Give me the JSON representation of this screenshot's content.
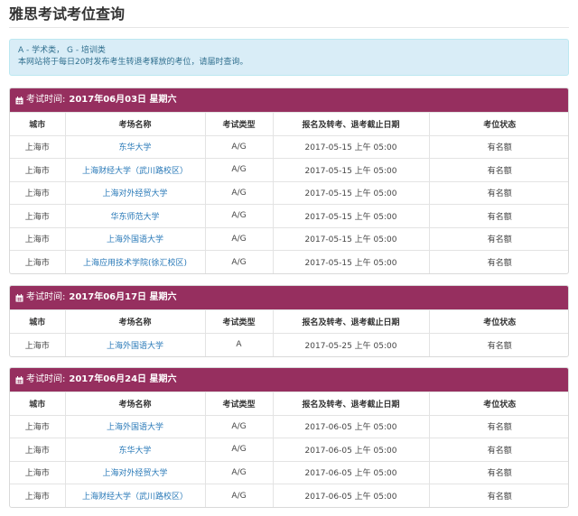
{
  "page": {
    "title": "雅思考试考位查询"
  },
  "info": {
    "line1": "A - 学术类， G - 培训类",
    "line2": "本网站将于每日20时发布考生转退考释放的考位，请届时查询。"
  },
  "columns": [
    "城市",
    "考场名称",
    "考试类型",
    "报名及转考、退考截止日期",
    "考位状态"
  ],
  "sections": [
    {
      "label": "考试时间:",
      "date": "2017年06月03日 星期六",
      "rows": [
        {
          "city": "上海市",
          "venue": "东华大学",
          "type": "A/G",
          "deadline": "2017-05-15 上午 05:00",
          "status": "有名额"
        },
        {
          "city": "上海市",
          "venue": "上海财经大学（武川路校区）",
          "type": "A/G",
          "deadline": "2017-05-15 上午 05:00",
          "status": "有名额"
        },
        {
          "city": "上海市",
          "venue": "上海对外经贸大学",
          "type": "A/G",
          "deadline": "2017-05-15 上午 05:00",
          "status": "有名额"
        },
        {
          "city": "上海市",
          "venue": "华东师范大学",
          "type": "A/G",
          "deadline": "2017-05-15 上午 05:00",
          "status": "有名额"
        },
        {
          "city": "上海市",
          "venue": "上海外国语大学",
          "type": "A/G",
          "deadline": "2017-05-15 上午 05:00",
          "status": "有名额"
        },
        {
          "city": "上海市",
          "venue": "上海应用技术学院(徐汇校区)",
          "type": "A/G",
          "deadline": "2017-05-15 上午 05:00",
          "status": "有名额"
        }
      ]
    },
    {
      "label": "考试时间:",
      "date": "2017年06月17日 星期六",
      "rows": [
        {
          "city": "上海市",
          "venue": "上海外国语大学",
          "type": "A",
          "deadline": "2017-05-25 上午 05:00",
          "status": "有名额"
        }
      ]
    },
    {
      "label": "考试时间:",
      "date": "2017年06月24日 星期六",
      "rows": [
        {
          "city": "上海市",
          "venue": "上海外国语大学",
          "type": "A/G",
          "deadline": "2017-06-05 上午 05:00",
          "status": "有名额"
        },
        {
          "city": "上海市",
          "venue": "东华大学",
          "type": "A/G",
          "deadline": "2017-06-05 上午 05:00",
          "status": "有名额"
        },
        {
          "city": "上海市",
          "venue": "上海对外经贸大学",
          "type": "A/G",
          "deadline": "2017-06-05 上午 05:00",
          "status": "有名额"
        },
        {
          "city": "上海市",
          "venue": "上海财经大学（武川路校区）",
          "type": "A/G",
          "deadline": "2017-06-05 上午 05:00",
          "status": "有名额"
        }
      ]
    }
  ],
  "colors": {
    "header_bg": "#962f5f",
    "info_bg": "#d9edf7",
    "info_text": "#31708f",
    "link": "#2a7ab8"
  },
  "icons": {
    "section": "calendar-icon"
  }
}
